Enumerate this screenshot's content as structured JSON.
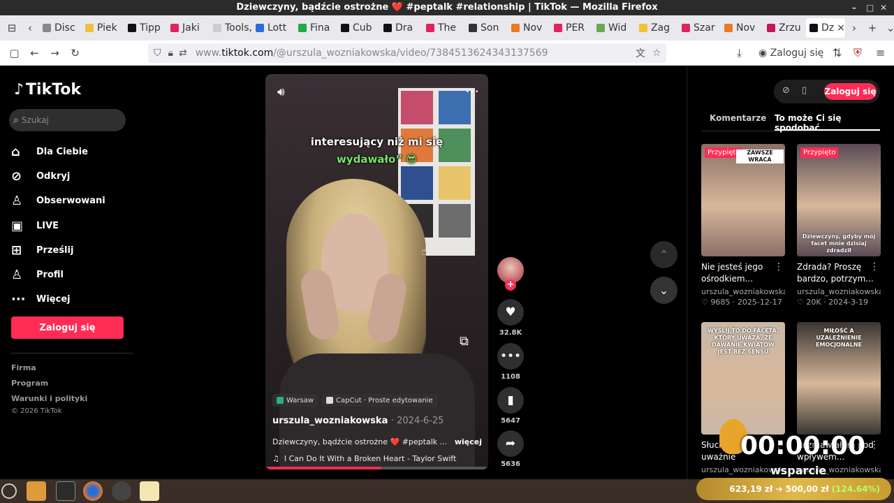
{
  "window": {
    "title": "Dziewczyny, bądźcie ostrożne ❤️ #peptalk #relationship | TikTok — Mozilla Firefox",
    "controls": [
      "–",
      "□",
      "✕"
    ]
  },
  "tabs": [
    {
      "label": "Disc",
      "color": "#888888"
    },
    {
      "label": "Piek",
      "color": "#f0c040"
    },
    {
      "label": "Tipp",
      "color": "#111111"
    },
    {
      "label": "Jaki",
      "color": "#e0245e"
    },
    {
      "label": "Tools, t",
      "color": "#cccccc"
    },
    {
      "label": "Lott",
      "color": "#2a6dd9"
    },
    {
      "label": "Fina",
      "color": "#22aa44"
    },
    {
      "label": "Cub",
      "color": "#111111"
    },
    {
      "label": "Dra",
      "color": "#111111"
    },
    {
      "label": "The",
      "color": "#e0245e"
    },
    {
      "label": "Son",
      "color": "#333333"
    },
    {
      "label": "Nov",
      "color": "#e97a26"
    },
    {
      "label": "PER",
      "color": "#e0245e"
    },
    {
      "label": "Wid",
      "color": "#6aa84f"
    },
    {
      "label": "Zag",
      "color": "#f1c232"
    },
    {
      "label": "Szar",
      "color": "#e0245e"
    },
    {
      "label": "Nov",
      "color": "#e97a26"
    },
    {
      "label": "Zrzu",
      "color": "#c2185b"
    },
    {
      "label": "Dz",
      "color": "#111111",
      "active": true
    }
  ],
  "navbar": {
    "url_prefix": "www.",
    "url_domain": "tiktok.com",
    "url_path": "/@urszula_wozniakowska/video/7384513624343137569",
    "login": "Zaloguj się"
  },
  "sidebar": {
    "logo": "TikTok",
    "search_placeholder": "Szukaj",
    "items": [
      {
        "label": "Dla Ciebie",
        "icon": "home-icon",
        "glyph": "⌂"
      },
      {
        "label": "Odkryj",
        "icon": "compass-icon",
        "glyph": "⊘"
      },
      {
        "label": "Obserwowani",
        "icon": "user-follow-icon",
        "glyph": "♙"
      },
      {
        "label": "LIVE",
        "icon": "live-icon",
        "glyph": "▣"
      },
      {
        "label": "Prześlij",
        "icon": "upload-icon",
        "glyph": "⊞"
      },
      {
        "label": "Profil",
        "icon": "profile-icon",
        "glyph": "♙"
      },
      {
        "label": "Więcej",
        "icon": "more-icon",
        "glyph": "···"
      }
    ],
    "login_button": "Zaloguj się",
    "footer": [
      "Firma",
      "Program",
      "Warunki i polityki",
      "© 2026 TikTok"
    ]
  },
  "video": {
    "caption_line1": "interesujący niż mi się",
    "caption_line2": "wydawało” 😎",
    "tag_location": "Warsaw",
    "tag_app": "CapCut · Proste edytowanie",
    "author": "urszula_wozniakowska",
    "date": "· 2024-6-25",
    "description": "Dziewczyny, bądźcie ostrożne ❤️ #peptalk ...",
    "more": "więcej",
    "music": "I Can Do It With a Broken Heart - Taylor Swift",
    "progress": 0.52
  },
  "actions": [
    {
      "icon": "heart-icon",
      "glyph": "♥",
      "count": "32.8K"
    },
    {
      "icon": "comment-icon",
      "glyph": "•••",
      "count": "1108"
    },
    {
      "icon": "bookmark-icon",
      "glyph": "▮",
      "count": "5647"
    },
    {
      "icon": "share-icon",
      "glyph": "➦",
      "count": "5636"
    }
  ],
  "right_panel": {
    "login": "Zaloguj się",
    "tab_comments": "Komentarze",
    "tab_suggested": "To może Ci się spodobać",
    "cards": [
      {
        "pinned": "Przypięto",
        "title": "Nie jesteś jego ośrodkiem...",
        "user": "urszula_wozniakowska",
        "likes": "9685",
        "date": "2025-12-17",
        "thumb_text": "ZAWSZE WRACA",
        "bg": "#8a6f66"
      },
      {
        "pinned": "Przypięto",
        "title": "Zdrada? Proszę bardzo, potrzym...",
        "user": "urszula_wozniakowska",
        "likes": "20K",
        "date": "2024-3-19",
        "thumb_text": "Dziewczyny, gdyby mój facet mnie dzisiaj zdradził",
        "bg": "#5a4b55"
      },
      {
        "pinned": "",
        "title": "Słuchajcie uważnie panowie...",
        "user": "urszula_wozniakowska",
        "likes": "",
        "date": "",
        "thumb_text": "WYŚLIJ TO DO FACETA, KTÓRY UWAŻA, ŻE DAWANIE KWIATÓW JEST BEZ SENSU",
        "bg": "#c9b8a8"
      },
      {
        "pinned": "",
        "title": "Rozmawiałam pod wpływem...",
        "user": "urszula_wozniakowska",
        "likes": "",
        "date": "",
        "thumb_text": "MIŁOŚĆ A UZALEŻNIENIE EMOCJONALNE",
        "bg": "#3a3532"
      }
    ]
  },
  "overlay": {
    "timer": "00:00:00",
    "support": "wsparcie",
    "goal": "623,19 zł ➔ 500,00 zł",
    "goal_pct": "(124.64%)"
  }
}
